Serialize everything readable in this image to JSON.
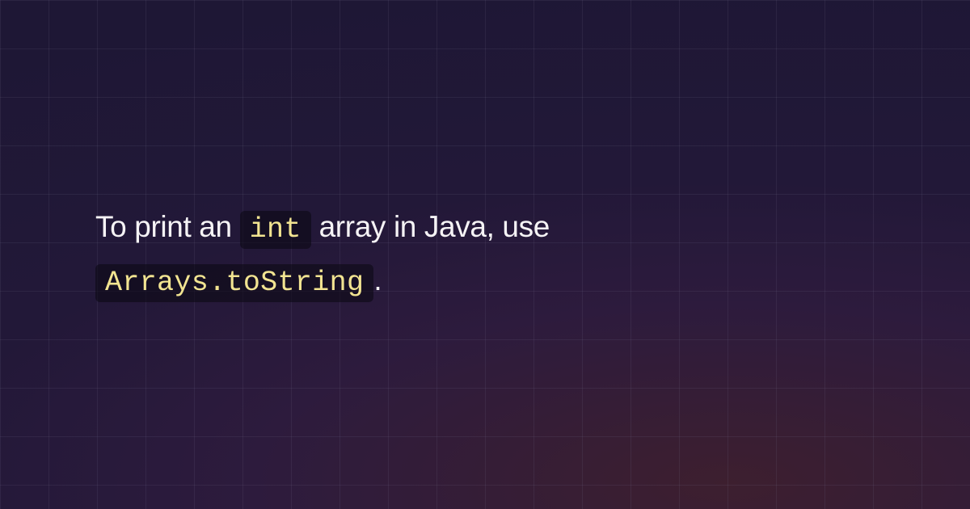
{
  "content": {
    "part1": "To print an ",
    "code1": "int",
    "part2": " array in Java, use ",
    "code2": "Arrays.toString",
    "part3": "."
  }
}
